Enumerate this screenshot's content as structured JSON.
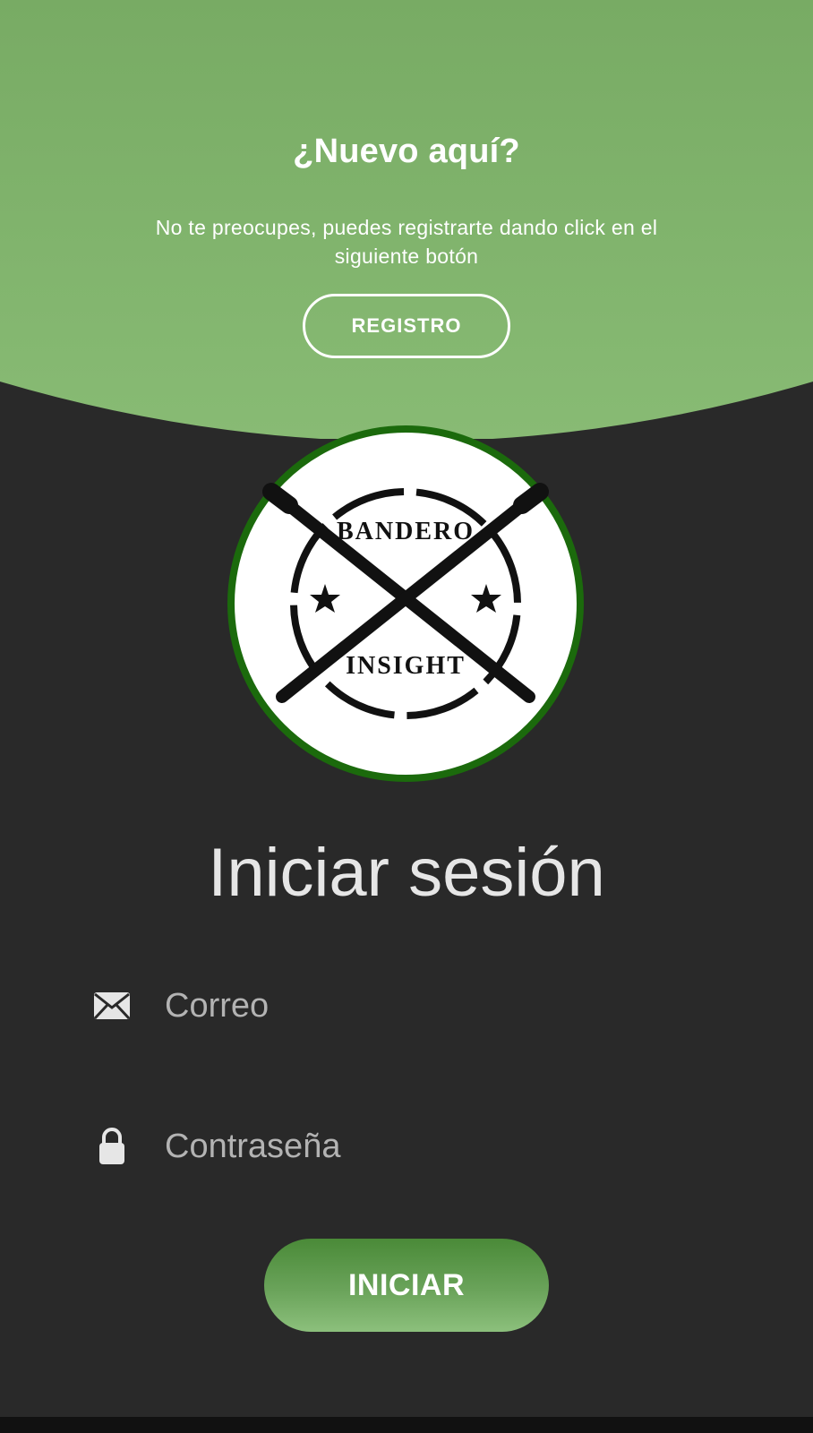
{
  "colors": {
    "background": "#292929",
    "top_panel_green": "#7db068",
    "logo_ring": "#1b6a0c",
    "login_button": "#6aa35a"
  },
  "register_panel": {
    "title": "¿Nuevo aquí?",
    "text": "No te preocupes, puedes registrarte dando click en el siguiente botón",
    "button_label": "REGISTRO"
  },
  "logo": {
    "line1": "BANDERO",
    "line2": "INSIGHT"
  },
  "login": {
    "title": "Iniciar sesión",
    "email_placeholder": "Correo",
    "email_icon": "envelope-icon",
    "password_placeholder": "Contraseña",
    "password_icon": "lock-icon",
    "button_label": "INICIAR"
  }
}
